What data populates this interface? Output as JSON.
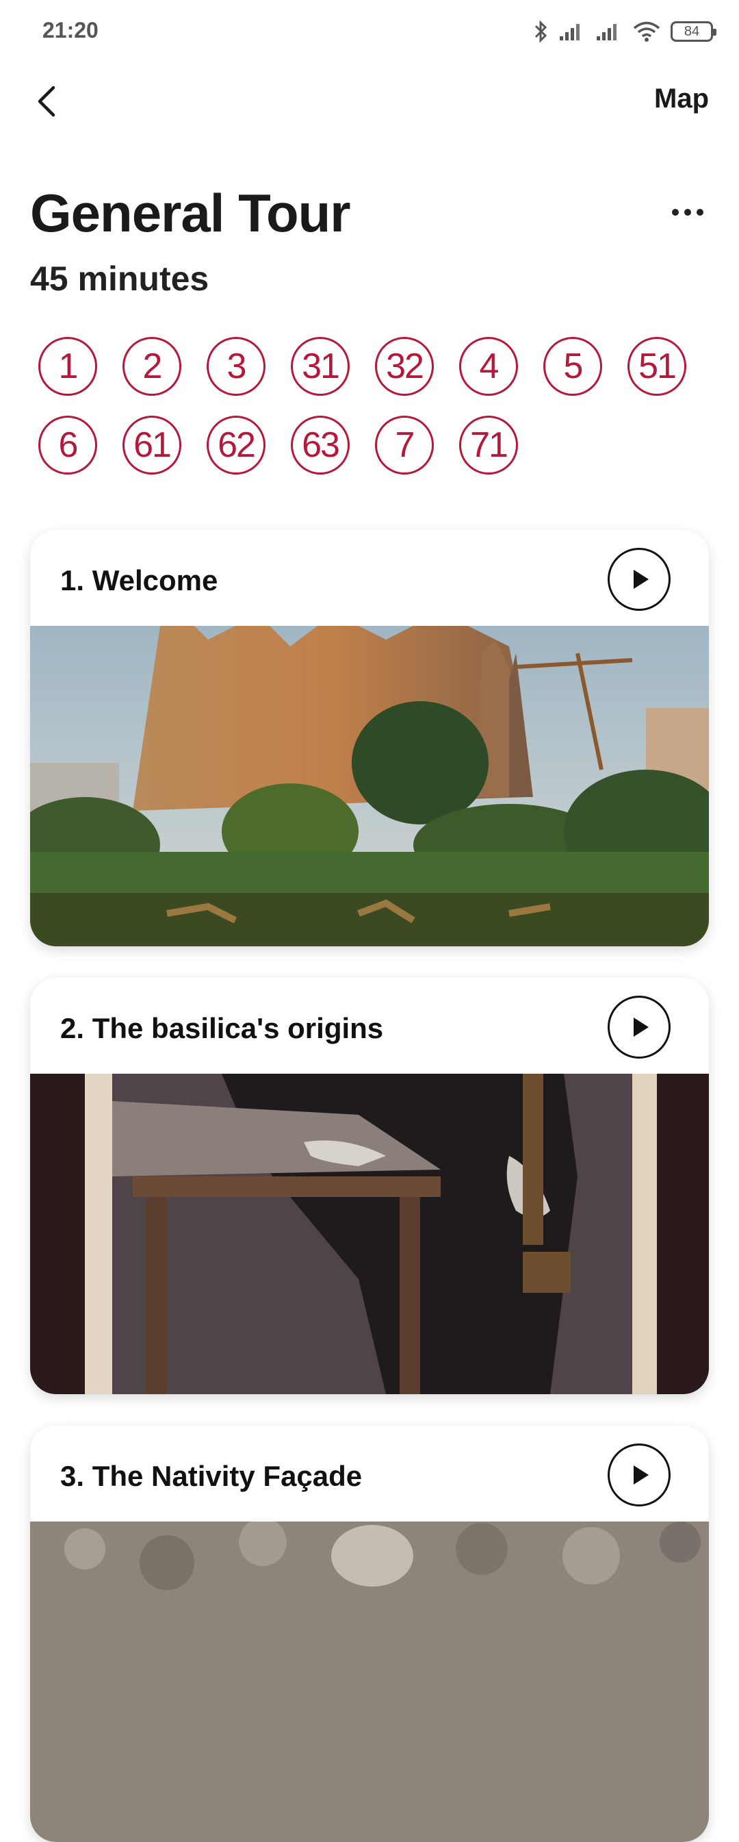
{
  "status": {
    "time": "21:20",
    "battery": "84",
    "icons": [
      "bluetooth-icon",
      "signal-icon",
      "signal-icon",
      "wifi-icon",
      "battery-icon"
    ]
  },
  "nav": {
    "back_icon": "chevron-left-icon",
    "map_label": "Map"
  },
  "tour": {
    "title": "General Tour",
    "duration": "45 minutes",
    "more_icon": "more-horizontal-icon"
  },
  "stops_row1": [
    "1",
    "2",
    "3",
    "31",
    "32",
    "4",
    "5",
    "51"
  ],
  "stops_row2": [
    "6",
    "61",
    "62",
    "63",
    "7",
    "71"
  ],
  "cards": [
    {
      "title": "1. Welcome",
      "image": "sagrada-familia-exterior"
    },
    {
      "title": "2. The basilica's origins",
      "image": "painting-man-at-desk"
    },
    {
      "title": "3. The Nativity Façade",
      "image": "carved-stone-facade"
    }
  ],
  "colors": {
    "accent": "#b5183a"
  }
}
